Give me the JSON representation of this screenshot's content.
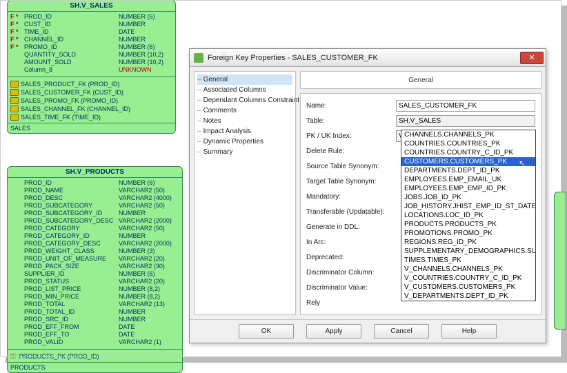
{
  "canvas": {
    "entity_sales": {
      "title": "SH.V_SALES",
      "columns": [
        {
          "sym": "F *",
          "name": "PROD_ID",
          "type": "NUMBER (6)"
        },
        {
          "sym": "F *",
          "name": "CUST_ID",
          "type": "NUMBER"
        },
        {
          "sym": "F *",
          "name": "TIME_ID",
          "type": "DATE"
        },
        {
          "sym": "F *",
          "name": "CHANNEL_ID",
          "type": "NUMBER"
        },
        {
          "sym": "F *",
          "name": "PROMO_ID",
          "type": "NUMBER (6)"
        },
        {
          "sym": "",
          "name": "QUANTITY_SOLD",
          "type": "NUMBER (10,2)"
        },
        {
          "sym": "",
          "name": "AMOUNT_SOLD",
          "type": "NUMBER (10,2)"
        },
        {
          "sym": "",
          "name": "Column_8",
          "type": "UNKNOWN",
          "unknown": true
        }
      ],
      "fks": [
        "SALES_PRODUCT_FK (PROD_ID)",
        "SALES_CUSTOMER_FK (CUST_ID)",
        "SALES_PROMO_FK (PROMO_ID)",
        "SALES_CHANNEL_FK (CHANNEL_ID)",
        "SALES_TIME_FK (TIME_ID)"
      ],
      "foot": "SALES"
    },
    "entity_products": {
      "title": "SH.V_PRODUCTS",
      "columns": [
        {
          "name": "PROD_ID",
          "type": "NUMBER (6)"
        },
        {
          "name": "PROD_NAME",
          "type": "VARCHAR2 (50)"
        },
        {
          "name": "PROD_DESC",
          "type": "VARCHAR2 (4000)"
        },
        {
          "name": "PROD_SUBCATEGORY",
          "type": "VARCHAR2 (50)"
        },
        {
          "name": "PROD_SUBCATEGORY_ID",
          "type": "NUMBER"
        },
        {
          "name": "PROD_SUBCATEGORY_DESC",
          "type": "VARCHAR2 (2000)"
        },
        {
          "name": "PROD_CATEGORY",
          "type": "VARCHAR2 (50)"
        },
        {
          "name": "PROD_CATEGORY_ID",
          "type": "NUMBER"
        },
        {
          "name": "PROD_CATEGORY_DESC",
          "type": "VARCHAR2 (2000)"
        },
        {
          "name": "PROD_WEIGHT_CLASS",
          "type": "NUMBER (3)"
        },
        {
          "name": "PROD_UNIT_OF_MEASURE",
          "type": "VARCHAR2 (20)"
        },
        {
          "name": "PROD_PACK_SIZE",
          "type": "VARCHAR2 (30)"
        },
        {
          "name": "SUPPLIER_ID",
          "type": "NUMBER (6)"
        },
        {
          "name": "PROD_STATUS",
          "type": "VARCHAR2 (20)"
        },
        {
          "name": "PROD_LIST_PRICE",
          "type": "NUMBER (8,2)"
        },
        {
          "name": "PROD_MIN_PRICE",
          "type": "NUMBER (8,2)"
        },
        {
          "name": "PROD_TOTAL",
          "type": "VARCHAR2 (13)"
        },
        {
          "name": "PROD_TOTAL_ID",
          "type": "NUMBER"
        },
        {
          "name": "PROD_SRC_ID",
          "type": "NUMBER"
        },
        {
          "name": "PROD_EFF_FROM",
          "type": "DATE"
        },
        {
          "name": "PROD_EFF_TO",
          "type": "DATE"
        },
        {
          "name": "PROD_VALID",
          "type": "VARCHAR2 (1)"
        }
      ],
      "pk": "PRODUCTS_PK (PROD_ID)",
      "foot": "PRODUCTS"
    }
  },
  "dialog": {
    "title": "Foreign Key Properties - SALES_CUSTOMER_FK",
    "nav": [
      "General",
      "Associated Columns",
      "Dependant Columns Constraint",
      "Comments",
      "Notes",
      "Impact Analysis",
      "Dynamic Properties",
      "Summary"
    ],
    "panel_head": "General",
    "fields": {
      "name_label": "Name:",
      "name_value": "SALES_CUSTOMER_FK",
      "table_label": "Table:",
      "table_value": "SH.V_SALES",
      "pk_label": "PK / UK Index:",
      "pk_value": "V_CUSTOMERS.CUSTOMERS_PK",
      "delete_label": "Delete Rule:",
      "src_syn_label": "Source Table Synonym:",
      "tgt_syn_label": "Target Table Synonym:",
      "mand_label": "Mandatory:",
      "trans_label": "Transferable (Updatable):",
      "gen_label": "Generate in DDL:",
      "arc_label": "In Arc:",
      "depr_label": "Deprecated:",
      "disc_col_label": "Discriminator Column:",
      "disc_val_label": "Discriminator Value:",
      "rely_label": "Rely"
    },
    "dropdown": [
      "CHANNELS.CHANNELS_PK",
      "COUNTRIES.COUNTRIES_PK",
      "COUNTRIES.COUNTRY_C_ID_PK",
      "CUSTOMERS.CUSTOMERS_PK",
      "DEPARTMENTS.DEPT_ID_PK",
      "EMPLOYEES.EMP_EMAIL_UK",
      "EMPLOYEES.EMP_EMP_ID_PK",
      "JOBS.JOB_ID_PK",
      "JOB_HISTORY.JHIST_EMP_ID_ST_DATE_PK",
      "LOCATIONS.LOC_ID_PK",
      "PRODUCTS.PRODUCTS_PK",
      "PROMOTIONS.PROMO_PK",
      "REGIONS.REG_ID_PK",
      "SUPPLEMENTARY_DEMOGRAPHICS.SUPP_DEMO_PK",
      "TIMES.TIMES_PK",
      "V_CHANNELS.CHANNELS_PK",
      "V_COUNTRIES.COUNTRY_C_ID_PK",
      "V_CUSTOMERS.CUSTOMERS_PK",
      "V_DEPARTMENTS.DEPT_ID_PK"
    ],
    "dropdown_sel_index": 3,
    "buttons": {
      "ok": "OK",
      "apply": "Apply",
      "cancel": "Cancel",
      "help": "Help"
    }
  }
}
